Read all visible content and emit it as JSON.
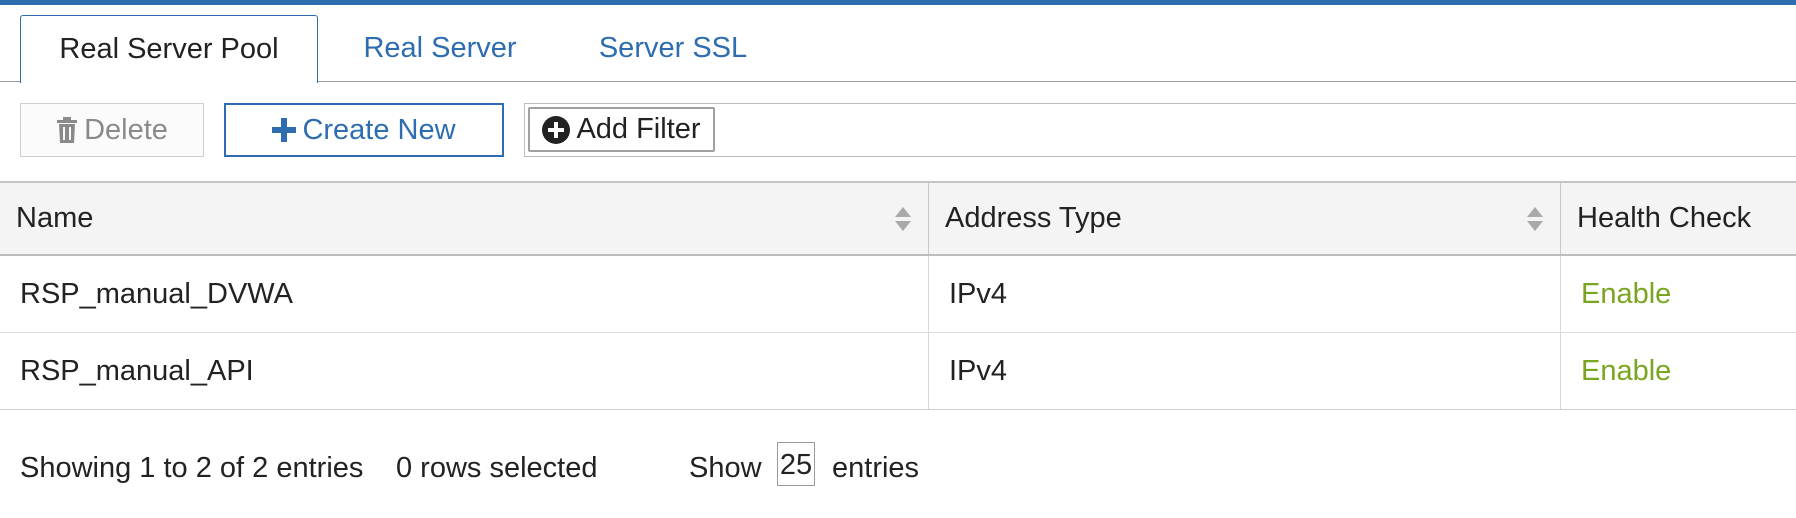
{
  "tabs": [
    {
      "label": "Real Server Pool",
      "active": true
    },
    {
      "label": "Real Server",
      "active": false
    },
    {
      "label": "Server SSL",
      "active": false
    }
  ],
  "toolbar": {
    "delete_label": "Delete",
    "create_label": "Create New",
    "filter_label": "Add Filter",
    "delete_icon": "trash-icon",
    "create_icon": "plus-icon",
    "filter_icon": "plus-circle-icon"
  },
  "table": {
    "headers": [
      "Name",
      "Address Type",
      "Health Check"
    ],
    "rows": [
      {
        "name": "RSP_manual_DVWA",
        "address_type": "IPv4",
        "health_check": "Enable"
      },
      {
        "name": "RSP_manual_API",
        "address_type": "IPv4",
        "health_check": "Enable"
      }
    ]
  },
  "footer": {
    "showing": "Showing 1 to 2 of 2 entries",
    "selected": "0 rows selected",
    "show_label": "Show",
    "page_size": "25",
    "entries_label": "entries"
  },
  "colors": {
    "accent": "#2e6db0",
    "enabled": "#79a521"
  }
}
